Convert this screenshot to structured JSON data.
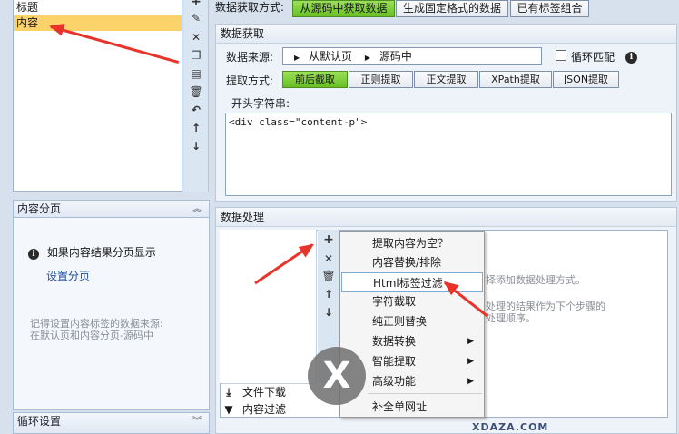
{
  "field_list": {
    "items": [
      "标题",
      "内容"
    ],
    "selected_index": 1
  },
  "field_tools": [
    "plus-icon",
    "pencil-icon",
    "close-icon",
    "copy-icon",
    "paste-icon",
    "trash-icon",
    "undo-icon",
    "arrow-up-icon",
    "arrow-down-icon"
  ],
  "pagination": {
    "title": "内容分页",
    "info_text": "如果内容结果分页显示",
    "link": "设置分页",
    "note_line1": "记得设置内容标签的数据来源:",
    "note_line2": "在默认页和内容分页-源码中"
  },
  "loop": {
    "title": "循环设置"
  },
  "method": {
    "label": "数据获取方式:",
    "tabs": [
      "从源码中获取数据",
      "生成固定格式的数据",
      "已有标签组合"
    ],
    "active": 0
  },
  "fetch": {
    "title": "数据获取",
    "source_label": "数据来源:",
    "source_parts": [
      "从默认页",
      "源码中"
    ],
    "loop_match_label": "循环匹配",
    "extract_label": "提取方式:",
    "extract_buttons": [
      "前后截取",
      "正则提取",
      "正文提取",
      "XPath提取",
      "JSON提取"
    ],
    "extract_active": 0,
    "start_label": "开头字符串:",
    "start_value": "<div class=\"content-p\">"
  },
  "processing": {
    "title": "数据处理",
    "bg_text1": "择添加数据处理方式。",
    "bg_text2": "处理的结果作为下个步骤的",
    "bg_text3": "处理顺序。",
    "bottom_items": [
      "文件下载",
      "内容过滤"
    ]
  },
  "context_menu": {
    "items": [
      {
        "label": "提取内容为空？",
        "submenu": false
      },
      {
        "label": "内容替换/排除",
        "submenu": false
      },
      {
        "label": "Html标签过滤",
        "submenu": false,
        "highlighted": true
      },
      {
        "label": "字符截取",
        "submenu": false
      },
      {
        "label": "纯正则替换",
        "submenu": false
      },
      {
        "label": "数据转换",
        "submenu": true
      },
      {
        "label": "智能提取",
        "submenu": true
      },
      {
        "label": "高级功能",
        "submenu": true
      },
      {
        "label": "补全单网址",
        "submenu": false
      }
    ]
  },
  "watermark": {
    "glyph": "X",
    "text": "XDAZA.COM"
  },
  "colors": {
    "active_tab": "#7fcf3c",
    "selected_row": "#fbd36a",
    "arrow": "#e8332a"
  }
}
